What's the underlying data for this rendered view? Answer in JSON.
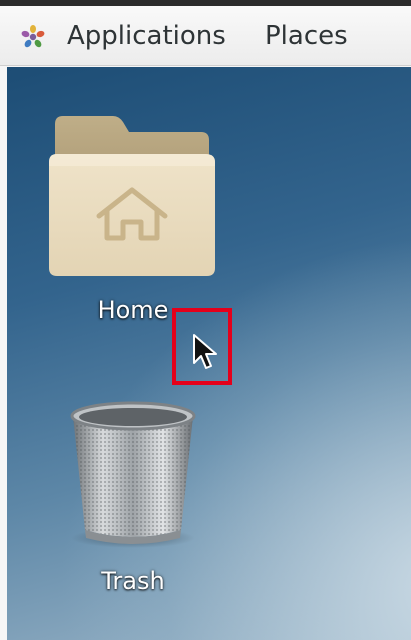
{
  "top_panel": {
    "applications_label": "Applications",
    "places_label": "Places",
    "applications_icon": "gnome-foot-icon"
  },
  "desktop": {
    "icons": [
      {
        "label": "Home",
        "icon": "home-folder-icon"
      },
      {
        "label": "Trash",
        "icon": "trash-bin-icon"
      }
    ]
  },
  "overlay": {
    "highlight_color": "#e4001b",
    "cursor": "arrow-cursor-icon"
  }
}
